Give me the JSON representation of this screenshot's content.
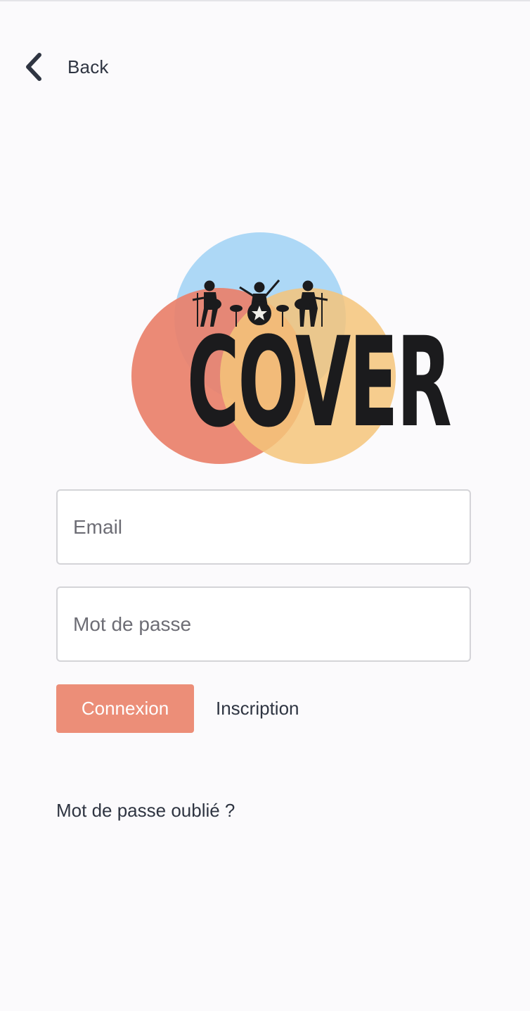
{
  "nav": {
    "back_label": "Back",
    "back_icon": "chevron-left-icon"
  },
  "logo": {
    "wordmark": "COVER",
    "colors": {
      "blue": "#a9d6f5",
      "red": "#e9806a",
      "orange": "#f5c47a"
    }
  },
  "form": {
    "email_placeholder": "Email",
    "email_value": "",
    "password_placeholder": "Mot de passe",
    "password_value": ""
  },
  "actions": {
    "login_label": "Connexion",
    "signup_label": "Inscription",
    "forgot_label": "Mot de passe oublié ?"
  },
  "theme": {
    "accent": "#ec8e78",
    "text": "#2f3542",
    "background": "#fbfafc"
  }
}
